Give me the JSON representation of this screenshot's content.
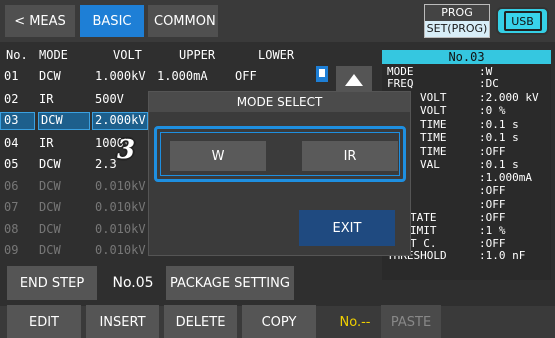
{
  "tabs": {
    "meas": "< MEAS",
    "basic": "BASIC",
    "common": "COMMON"
  },
  "prog_badge": {
    "top": "PROG",
    "bottom": "SET(PROG)"
  },
  "usb_label": "USB",
  "table": {
    "headers": [
      "No.",
      "MODE",
      "VOLT",
      "UPPER",
      "LOWER"
    ],
    "rows": [
      {
        "no": "01",
        "mode": "DCW",
        "volt": "1.000kV",
        "upper": "1.000mA",
        "lower": "OFF"
      },
      {
        "no": "02",
        "mode": "IR",
        "volt": "500V",
        "upper": "",
        "lower": ""
      },
      {
        "no": "03",
        "mode": "DCW",
        "volt": "2.000kV",
        "upper": "",
        "lower": ""
      },
      {
        "no": "04",
        "mode": "IR",
        "volt": "1000V",
        "upper": "",
        "lower": ""
      },
      {
        "no": "05",
        "mode": "DCW",
        "volt": "2.3",
        "upper": "",
        "lower": ""
      },
      {
        "no": "06",
        "mode": "DCW",
        "volt": "0.010kV",
        "upper": "",
        "lower": ""
      },
      {
        "no": "07",
        "mode": "DCW",
        "volt": "0.010kV",
        "upper": "",
        "lower": ""
      },
      {
        "no": "08",
        "mode": "DCW",
        "volt": "0.010kV",
        "upper": "",
        "lower": ""
      },
      {
        "no": "09",
        "mode": "DCW",
        "volt": "0.010kV",
        "upper": "",
        "lower": ""
      }
    ]
  },
  "panel": {
    "title": "No.03",
    "rows": [
      {
        "label": "MODE",
        "value": ":W"
      },
      {
        "label": "FREQ",
        "value": ":DC"
      },
      {
        "label": "VOLT",
        "value": ":2.000 kV"
      },
      {
        "label": "VOLT",
        "value": ":0 %"
      },
      {
        "label": "TIME",
        "value": ":0.1 s"
      },
      {
        "label": "TIME",
        "value": ":0.1 s"
      },
      {
        "label": "TIME",
        "value": ":OFF"
      },
      {
        "label": "VAL",
        "value": ":0.1 s"
      },
      {
        "label": "",
        "value": ":1.000mA"
      },
      {
        "label": "",
        "value": ":OFF"
      },
      {
        "label": "",
        "value": ":OFF"
      },
      {
        "label": "TATE",
        "value": ":OFF"
      },
      {
        "label": "IMIT",
        "value": ":1 %"
      },
      {
        "label": "T C.",
        "value": ":OFF"
      },
      {
        "label": "THRESHOLD",
        "value": ":1.0 nF"
      }
    ]
  },
  "mid": {
    "end_step": "END STEP",
    "step_no": "No.05",
    "package": "PACKAGE SETTING"
  },
  "bottom": {
    "edit": "EDIT",
    "insert": "INSERT",
    "delete": "DELETE",
    "copy": "COPY",
    "no": "No.--",
    "paste": "PASTE"
  },
  "dialog": {
    "title": "MODE SELECT",
    "option_w": "W",
    "option_ir": "IR",
    "exit": "EXIT"
  },
  "callout": "3",
  "colors": {
    "accent": "#1e7fd6",
    "panel_header": "#35c7e0",
    "yellow": "#f0d000"
  }
}
